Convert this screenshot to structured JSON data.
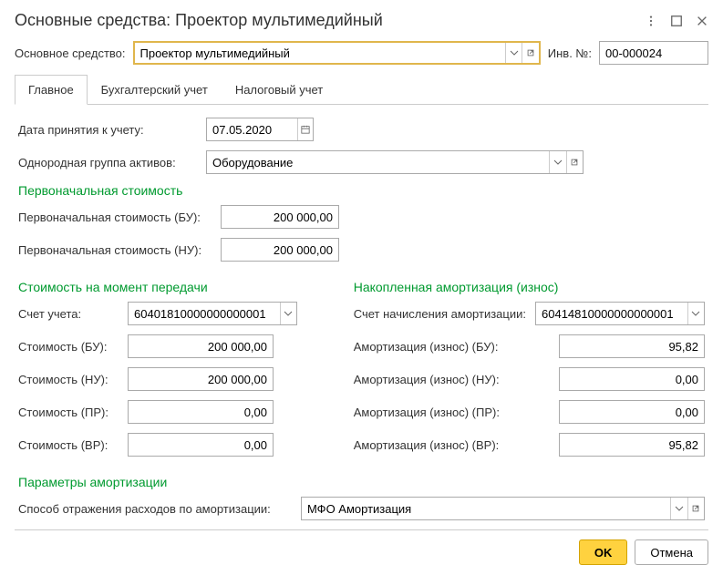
{
  "header": {
    "title": "Основные средства: Проектор мультимедийный"
  },
  "topRow": {
    "assetLabel": "Основное средство:",
    "assetValue": "Проектор мультимедийный",
    "invLabel": "Инв. №:",
    "invValue": "00-000024"
  },
  "tabs": {
    "t0": "Главное",
    "t1": "Бухгалтерский учет",
    "t2": "Налоговый учет"
  },
  "main": {
    "dateLabel": "Дата принятия к учету:",
    "dateValue": "07.05.2020",
    "groupLabel": "Однородная группа активов:",
    "groupValue": "Оборудование",
    "section1": "Первоначальная стоимость",
    "initCostBULabel": "Первоначальная стоимость (БУ):",
    "initCostBUValue": "200 000,00",
    "initCostNULabel": "Первоначальная стоимость (НУ):",
    "initCostNUValue": "200 000,00",
    "section2": "Стоимость на момент передачи",
    "section3": "Накопленная амортизация (износ)",
    "accountLabel": "Счет учета:",
    "accountValue": "60401810000000000001",
    "amortAccountLabel": "Счет начисления амортизации:",
    "amortAccountValue": "60414810000000000001",
    "costBULabel": "Стоимость (БУ):",
    "costBUValue": "200 000,00",
    "costNULabel": "Стоимость (НУ):",
    "costNUValue": "200 000,00",
    "costPRLabel": "Стоимость (ПР):",
    "costPRValue": "0,00",
    "costVRLabel": "Стоимость (ВР):",
    "costVRValue": "0,00",
    "amortBULabel": "Амортизация (износ) (БУ):",
    "amortBUValue": "95,82",
    "amortNULabel": "Амортизация (износ) (НУ):",
    "amortNUValue": "0,00",
    "amortPRLabel": "Амортизация (износ) (ПР):",
    "amortPRValue": "0,00",
    "amortVRLabel": "Амортизация (износ) (ВР):",
    "amortVRValue": "95,82",
    "section4": "Параметры амортизации",
    "reflectLabel": "Способ отражения расходов по амортизации:",
    "reflectValue": "МФО Амортизация"
  },
  "footer": {
    "ok": "OK",
    "cancel": "Отмена"
  }
}
